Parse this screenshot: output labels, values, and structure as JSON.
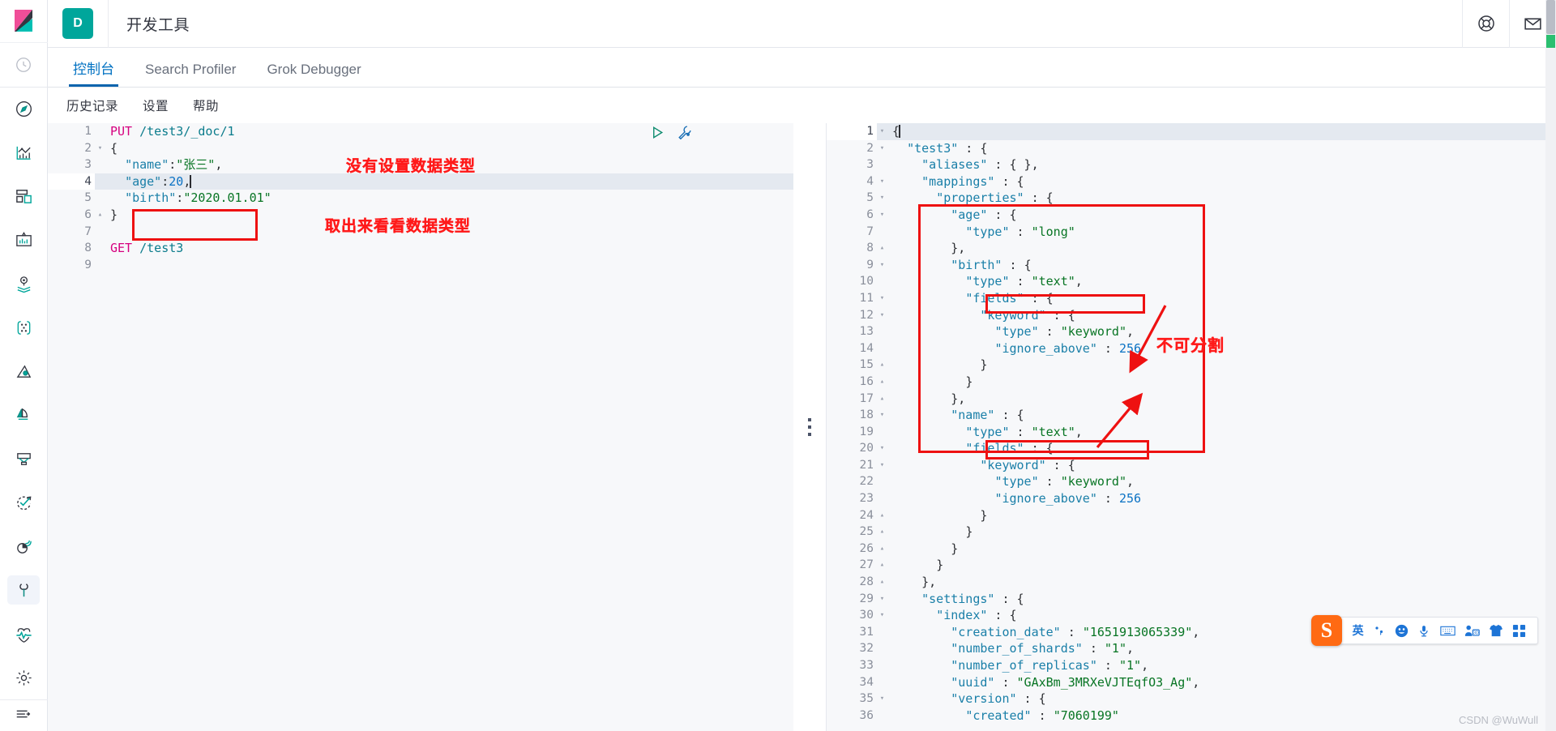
{
  "header": {
    "space_badge": "D",
    "title": "开发工具",
    "help_icon": "lifebuoy-icon",
    "news_icon": "mail-icon"
  },
  "sidebar": {
    "logo_icon": "kibana-logo-icon",
    "items": [
      {
        "icon": "clock-recent-icon",
        "name": "recently-viewed"
      },
      {
        "icon": "compass-discover-icon",
        "name": "discover"
      },
      {
        "icon": "visualize-chart-icon",
        "name": "visualize"
      },
      {
        "icon": "dashboard-grid-icon",
        "name": "dashboard"
      },
      {
        "icon": "canvas-presentation-icon",
        "name": "canvas"
      },
      {
        "icon": "maps-pin-layers-icon",
        "name": "maps"
      },
      {
        "icon": "graph-nodes-icon",
        "name": "graph"
      },
      {
        "icon": "machine-learning-icon",
        "name": "machine-learning"
      },
      {
        "icon": "apm-signal-icon",
        "name": "apm"
      },
      {
        "icon": "uptime-monitor-icon",
        "name": "uptime"
      },
      {
        "icon": "siem-check-icon",
        "name": "siem"
      },
      {
        "icon": "monitoring-pie-icon",
        "name": "monitoring"
      },
      {
        "icon": "wrench-devtools-icon",
        "name": "dev-tools",
        "active": true
      },
      {
        "icon": "heartbeat-icon",
        "name": "stack-management-health"
      },
      {
        "icon": "gear-settings-icon",
        "name": "management"
      }
    ],
    "collapse_icon": "collapse-arrow-icon"
  },
  "tabs": [
    {
      "label": "控制台",
      "active": true
    },
    {
      "label": "Search Profiler",
      "active": false
    },
    {
      "label": "Grok Debugger",
      "active": false
    }
  ],
  "submenu": [
    "历史记录",
    "设置",
    "帮助"
  ],
  "editor_actions": {
    "play_icon": "play-triangle-icon",
    "wrench_icon": "wrench-icon"
  },
  "request_editor": {
    "lines": [
      {
        "n": "1",
        "fold": "",
        "tokens": [
          {
            "t": "PUT",
            "c": "method"
          },
          {
            "t": " ",
            "c": "plain"
          },
          {
            "t": "/test3/_doc/1",
            "c": "url"
          }
        ]
      },
      {
        "n": "2",
        "fold": "▾",
        "tokens": [
          {
            "t": "{",
            "c": "punct"
          }
        ]
      },
      {
        "n": "3",
        "fold": "",
        "tokens": [
          {
            "t": "  ",
            "c": "plain"
          },
          {
            "t": "\"name\"",
            "c": "key"
          },
          {
            "t": ":",
            "c": "punct"
          },
          {
            "t": "\"张三\"",
            "c": "str"
          },
          {
            "t": ",",
            "c": "punct"
          }
        ]
      },
      {
        "n": "4",
        "fold": "",
        "highlight": true,
        "caret": true,
        "tokens": [
          {
            "t": "  ",
            "c": "plain"
          },
          {
            "t": "\"age\"",
            "c": "key"
          },
          {
            "t": ":",
            "c": "punct"
          },
          {
            "t": "20",
            "c": "num"
          },
          {
            "t": ",",
            "c": "punct"
          }
        ]
      },
      {
        "n": "5",
        "fold": "",
        "tokens": [
          {
            "t": "  ",
            "c": "plain"
          },
          {
            "t": "\"birth\"",
            "c": "key"
          },
          {
            "t": ":",
            "c": "punct"
          },
          {
            "t": "\"2020.01.01\"",
            "c": "str"
          }
        ]
      },
      {
        "n": "6",
        "fold": "▴",
        "tokens": [
          {
            "t": "}",
            "c": "punct"
          }
        ]
      },
      {
        "n": "7",
        "fold": "",
        "tokens": []
      },
      {
        "n": "8",
        "fold": "",
        "tokens": [
          {
            "t": "GET",
            "c": "method"
          },
          {
            "t": " ",
            "c": "plain"
          },
          {
            "t": "/test3",
            "c": "url"
          }
        ]
      },
      {
        "n": "9",
        "fold": "",
        "tokens": []
      }
    ]
  },
  "response_editor": {
    "lines": [
      {
        "n": "1",
        "fold": "▾",
        "highlight": true,
        "caret": true,
        "indent": 0,
        "tokens": [
          {
            "t": "{",
            "c": "punct"
          }
        ]
      },
      {
        "n": "2",
        "fold": "▾",
        "tokens": [
          {
            "t": "  ",
            "c": "plain"
          },
          {
            "t": "\"test3\"",
            "c": "key"
          },
          {
            "t": " : ",
            "c": "punct"
          },
          {
            "t": "{",
            "c": "punct"
          }
        ]
      },
      {
        "n": "3",
        "fold": "",
        "tokens": [
          {
            "t": "    ",
            "c": "plain"
          },
          {
            "t": "\"aliases\"",
            "c": "key"
          },
          {
            "t": " : ",
            "c": "punct"
          },
          {
            "t": "{ },",
            "c": "punct"
          }
        ]
      },
      {
        "n": "4",
        "fold": "▾",
        "tokens": [
          {
            "t": "    ",
            "c": "plain"
          },
          {
            "t": "\"mappings\"",
            "c": "key"
          },
          {
            "t": " : ",
            "c": "punct"
          },
          {
            "t": "{",
            "c": "punct"
          }
        ]
      },
      {
        "n": "5",
        "fold": "▾",
        "tokens": [
          {
            "t": "      ",
            "c": "plain"
          },
          {
            "t": "\"properties\"",
            "c": "key"
          },
          {
            "t": " : ",
            "c": "punct"
          },
          {
            "t": "{",
            "c": "punct"
          }
        ]
      },
      {
        "n": "6",
        "fold": "▾",
        "tokens": [
          {
            "t": "        ",
            "c": "plain"
          },
          {
            "t": "\"age\"",
            "c": "key"
          },
          {
            "t": " : ",
            "c": "punct"
          },
          {
            "t": "{",
            "c": "punct"
          }
        ]
      },
      {
        "n": "7",
        "fold": "",
        "tokens": [
          {
            "t": "          ",
            "c": "plain"
          },
          {
            "t": "\"type\"",
            "c": "key"
          },
          {
            "t": " : ",
            "c": "punct"
          },
          {
            "t": "\"long\"",
            "c": "str"
          }
        ]
      },
      {
        "n": "8",
        "fold": "▴",
        "tokens": [
          {
            "t": "        ",
            "c": "plain"
          },
          {
            "t": "},",
            "c": "punct"
          }
        ]
      },
      {
        "n": "9",
        "fold": "▾",
        "tokens": [
          {
            "t": "        ",
            "c": "plain"
          },
          {
            "t": "\"birth\"",
            "c": "key"
          },
          {
            "t": " : ",
            "c": "punct"
          },
          {
            "t": "{",
            "c": "punct"
          }
        ]
      },
      {
        "n": "10",
        "fold": "",
        "tokens": [
          {
            "t": "          ",
            "c": "plain"
          },
          {
            "t": "\"type\"",
            "c": "key"
          },
          {
            "t": " : ",
            "c": "punct"
          },
          {
            "t": "\"text\"",
            "c": "str"
          },
          {
            "t": ",",
            "c": "punct"
          }
        ]
      },
      {
        "n": "11",
        "fold": "▾",
        "tokens": [
          {
            "t": "          ",
            "c": "plain"
          },
          {
            "t": "\"fields\"",
            "c": "key"
          },
          {
            "t": " : ",
            "c": "punct"
          },
          {
            "t": "{",
            "c": "punct"
          }
        ]
      },
      {
        "n": "12",
        "fold": "▾",
        "tokens": [
          {
            "t": "            ",
            "c": "plain"
          },
          {
            "t": "\"keyword\"",
            "c": "key"
          },
          {
            "t": " : ",
            "c": "punct"
          },
          {
            "t": "{",
            "c": "punct"
          }
        ]
      },
      {
        "n": "13",
        "fold": "",
        "tokens": [
          {
            "t": "              ",
            "c": "plain"
          },
          {
            "t": "\"type\"",
            "c": "key"
          },
          {
            "t": " : ",
            "c": "punct"
          },
          {
            "t": "\"keyword\"",
            "c": "str"
          },
          {
            "t": ",",
            "c": "punct"
          }
        ]
      },
      {
        "n": "14",
        "fold": "",
        "tokens": [
          {
            "t": "              ",
            "c": "plain"
          },
          {
            "t": "\"ignore_above\"",
            "c": "key"
          },
          {
            "t": " : ",
            "c": "punct"
          },
          {
            "t": "256",
            "c": "num"
          }
        ]
      },
      {
        "n": "15",
        "fold": "▴",
        "tokens": [
          {
            "t": "            ",
            "c": "plain"
          },
          {
            "t": "}",
            "c": "punct"
          }
        ]
      },
      {
        "n": "16",
        "fold": "▴",
        "tokens": [
          {
            "t": "          ",
            "c": "plain"
          },
          {
            "t": "}",
            "c": "punct"
          }
        ]
      },
      {
        "n": "17",
        "fold": "▴",
        "tokens": [
          {
            "t": "        ",
            "c": "plain"
          },
          {
            "t": "},",
            "c": "punct"
          }
        ]
      },
      {
        "n": "18",
        "fold": "▾",
        "tokens": [
          {
            "t": "        ",
            "c": "plain"
          },
          {
            "t": "\"name\"",
            "c": "key"
          },
          {
            "t": " : ",
            "c": "punct"
          },
          {
            "t": "{",
            "c": "punct"
          }
        ]
      },
      {
        "n": "19",
        "fold": "",
        "tokens": [
          {
            "t": "          ",
            "c": "plain"
          },
          {
            "t": "\"type\"",
            "c": "key"
          },
          {
            "t": " : ",
            "c": "punct"
          },
          {
            "t": "\"text\"",
            "c": "str"
          },
          {
            "t": ",",
            "c": "punct"
          }
        ]
      },
      {
        "n": "20",
        "fold": "▾",
        "tokens": [
          {
            "t": "          ",
            "c": "plain"
          },
          {
            "t": "\"fields\"",
            "c": "key"
          },
          {
            "t": " : ",
            "c": "punct"
          },
          {
            "t": "{",
            "c": "punct"
          }
        ]
      },
      {
        "n": "21",
        "fold": "▾",
        "tokens": [
          {
            "t": "            ",
            "c": "plain"
          },
          {
            "t": "\"keyword\"",
            "c": "key"
          },
          {
            "t": " : ",
            "c": "punct"
          },
          {
            "t": "{",
            "c": "punct"
          }
        ]
      },
      {
        "n": "22",
        "fold": "",
        "tokens": [
          {
            "t": "              ",
            "c": "plain"
          },
          {
            "t": "\"type\"",
            "c": "key"
          },
          {
            "t": " : ",
            "c": "punct"
          },
          {
            "t": "\"keyword\"",
            "c": "str"
          },
          {
            "t": ",",
            "c": "punct"
          }
        ]
      },
      {
        "n": "23",
        "fold": "",
        "tokens": [
          {
            "t": "              ",
            "c": "plain"
          },
          {
            "t": "\"ignore_above\"",
            "c": "key"
          },
          {
            "t": " : ",
            "c": "punct"
          },
          {
            "t": "256",
            "c": "num"
          }
        ]
      },
      {
        "n": "24",
        "fold": "▴",
        "tokens": [
          {
            "t": "            ",
            "c": "plain"
          },
          {
            "t": "}",
            "c": "punct"
          }
        ]
      },
      {
        "n": "25",
        "fold": "▴",
        "tokens": [
          {
            "t": "          ",
            "c": "plain"
          },
          {
            "t": "}",
            "c": "punct"
          }
        ]
      },
      {
        "n": "26",
        "fold": "▴",
        "tokens": [
          {
            "t": "        ",
            "c": "plain"
          },
          {
            "t": "}",
            "c": "punct"
          }
        ]
      },
      {
        "n": "27",
        "fold": "▴",
        "tokens": [
          {
            "t": "      ",
            "c": "plain"
          },
          {
            "t": "}",
            "c": "punct"
          }
        ]
      },
      {
        "n": "28",
        "fold": "▴",
        "tokens": [
          {
            "t": "    ",
            "c": "plain"
          },
          {
            "t": "},",
            "c": "punct"
          }
        ]
      },
      {
        "n": "29",
        "fold": "▾",
        "tokens": [
          {
            "t": "    ",
            "c": "plain"
          },
          {
            "t": "\"settings\"",
            "c": "key"
          },
          {
            "t": " : ",
            "c": "punct"
          },
          {
            "t": "{",
            "c": "punct"
          }
        ]
      },
      {
        "n": "30",
        "fold": "▾",
        "tokens": [
          {
            "t": "      ",
            "c": "plain"
          },
          {
            "t": "\"index\"",
            "c": "key"
          },
          {
            "t": " : ",
            "c": "punct"
          },
          {
            "t": "{",
            "c": "punct"
          }
        ]
      },
      {
        "n": "31",
        "fold": "",
        "tokens": [
          {
            "t": "        ",
            "c": "plain"
          },
          {
            "t": "\"creation_date\"",
            "c": "key"
          },
          {
            "t": " : ",
            "c": "punct"
          },
          {
            "t": "\"1651913065339\"",
            "c": "str"
          },
          {
            "t": ",",
            "c": "punct"
          }
        ]
      },
      {
        "n": "32",
        "fold": "",
        "tokens": [
          {
            "t": "        ",
            "c": "plain"
          },
          {
            "t": "\"number_of_shards\"",
            "c": "key"
          },
          {
            "t": " : ",
            "c": "punct"
          },
          {
            "t": "\"1\"",
            "c": "str"
          },
          {
            "t": ",",
            "c": "punct"
          }
        ]
      },
      {
        "n": "33",
        "fold": "",
        "tokens": [
          {
            "t": "        ",
            "c": "plain"
          },
          {
            "t": "\"number_of_replicas\"",
            "c": "key"
          },
          {
            "t": " : ",
            "c": "punct"
          },
          {
            "t": "\"1\"",
            "c": "str"
          },
          {
            "t": ",",
            "c": "punct"
          }
        ]
      },
      {
        "n": "34",
        "fold": "",
        "tokens": [
          {
            "t": "        ",
            "c": "plain"
          },
          {
            "t": "\"uuid\"",
            "c": "key"
          },
          {
            "t": " : ",
            "c": "punct"
          },
          {
            "t": "\"GAxBm_3MRXeVJTEqfO3_Ag\"",
            "c": "str"
          },
          {
            "t": ",",
            "c": "punct"
          }
        ]
      },
      {
        "n": "35",
        "fold": "▾",
        "tokens": [
          {
            "t": "        ",
            "c": "plain"
          },
          {
            "t": "\"version\"",
            "c": "key"
          },
          {
            "t": " : ",
            "c": "punct"
          },
          {
            "t": "{",
            "c": "punct"
          }
        ]
      },
      {
        "n": "36",
        "fold": "",
        "tokens": [
          {
            "t": "          ",
            "c": "plain"
          },
          {
            "t": "\"created\"",
            "c": "key"
          },
          {
            "t": " : ",
            "c": "punct"
          },
          {
            "t": "\"7060199\"",
            "c": "str"
          }
        ]
      }
    ]
  },
  "annotations": [
    {
      "name": "anno-no-datatype",
      "text": "没有设置数据类型"
    },
    {
      "name": "anno-fetch-to-see",
      "text": "取出来看看数据类型"
    },
    {
      "name": "anno-not-splittable",
      "text": "不可分割"
    }
  ],
  "ime": {
    "logo": "S",
    "mode": "英",
    "items": [
      {
        "icon": "punctuation-icon",
        "glyph": "·,"
      },
      {
        "icon": "emoji-smile-icon",
        "glyph": "☺"
      },
      {
        "icon": "microphone-icon",
        "glyph": "🎤"
      },
      {
        "icon": "keyboard-icon",
        "glyph": "⌨"
      },
      {
        "icon": "user-3d-icon",
        "glyph": "3D"
      },
      {
        "icon": "skin-shirt-icon",
        "glyph": "👕"
      },
      {
        "icon": "apps-grid-icon",
        "glyph": "▦"
      }
    ]
  },
  "watermark": "CSDN @WuWull",
  "colors": {
    "accent_blue": "#0b64ad",
    "brand_teal": "#00a69b",
    "annotation_red": "#ff1a1a",
    "box_red": "#ee1111",
    "ime_orange": "#ff6a13"
  }
}
